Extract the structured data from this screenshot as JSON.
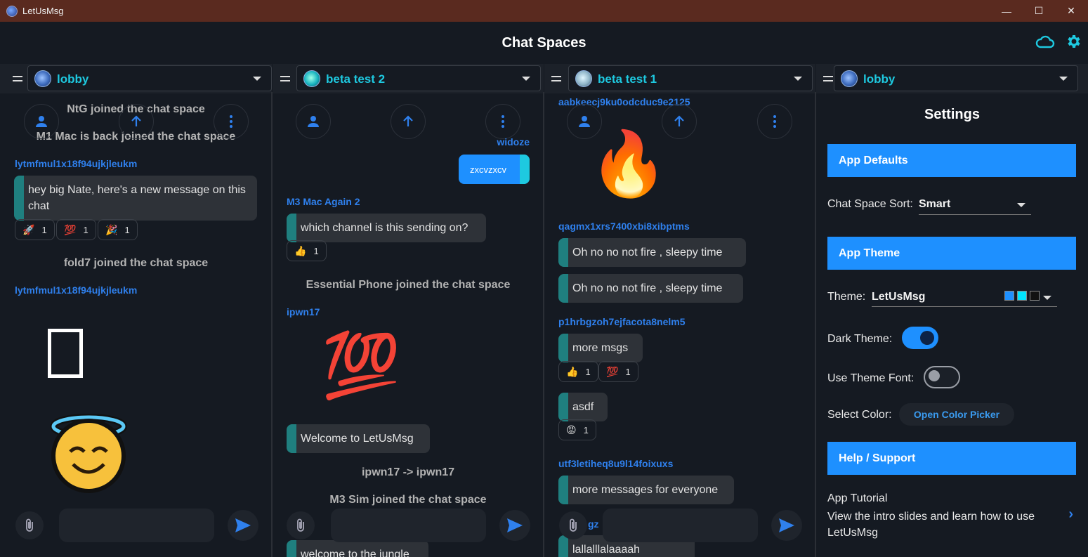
{
  "window": {
    "title": "LetUsMsg",
    "minimize": "—",
    "maximize": "☐",
    "close": "✕"
  },
  "header": {
    "title": "Chat Spaces",
    "cloud_icon": "cloud-icon",
    "settings_icon": "gear-icon"
  },
  "columns": [
    {
      "space": "lobby",
      "messages": {
        "sys1": "NtG joined the chat space",
        "sys2": "M1 Mac is back joined the chat space",
        "user1": "lytmfmul1x18f94ujkjleukm",
        "bubble1": "hey big Nate, here's a new message on this chat",
        "reactions": [
          {
            "emoji": "🚀",
            "count": "1"
          },
          {
            "emoji": "💯",
            "count": "1"
          },
          {
            "emoji": "🎉",
            "count": "1"
          }
        ],
        "sys3": "fold7 joined the chat space",
        "user2": "lytmfmul1x18f94ujkjleukm"
      }
    },
    {
      "space": "beta test 2",
      "messages": {
        "user_right": "widoze",
        "own_bubble": "zxcvzxcv",
        "user1": "M3 Mac Again 2",
        "bubble1": "which channel is this sending on?",
        "reaction1": {
          "emoji": "👍",
          "count": "1"
        },
        "sys1": "Essential Phone joined the chat space",
        "user2": "ipwn17",
        "emoji_big": "💯",
        "bubble2": "Welcome to LetUsMsg",
        "sys2": "ipwn17  ->  ipwn17",
        "sys3": "M3 Sim joined the chat space",
        "bubble3": "welcome to the jungle"
      }
    },
    {
      "space": "beta test 1",
      "messages": {
        "user1": "aabkeecj9ku0odcduc9e2125",
        "emoji_big": "🔥",
        "user2": "qagmx1xrs7400xbi8xibptms",
        "bubble1": "Oh no no not fire , sleepy time",
        "bubble2": "Oh no no not fire , sleepy time",
        "user3": "p1hrbgzoh7ejfacota8nelm5",
        "bubble3": "more msgs",
        "reactions": [
          {
            "emoji": "👍",
            "count": "1"
          },
          {
            "emoji": "💯",
            "count": "1"
          }
        ],
        "bubble4": "asdf",
        "reaction4": {
          "emoji": "😡",
          "count": "1"
        },
        "user4": "utf3letiheq8u9l14foixuxs",
        "bubble5": "more messages for everyone",
        "user5_partial": "gz",
        "bubble6": "lallalllalaaaah"
      }
    },
    {
      "space": "lobby"
    }
  ],
  "settings": {
    "title": "Settings",
    "app_defaults": "App Defaults",
    "sort_label": "Chat Space Sort:",
    "sort_value": "Smart",
    "app_theme": "App Theme",
    "theme_label": "Theme:",
    "theme_value": "LetUsMsg",
    "theme_colors": [
      "#1e90ff",
      "#00e5ff",
      "#121212"
    ],
    "dark_theme_label": "Dark Theme:",
    "dark_theme_on": true,
    "theme_font_label": "Use Theme Font:",
    "theme_font_on": false,
    "select_color_label": "Select Color:",
    "color_picker_button": "Open Color Picker",
    "help": "Help / Support",
    "tutorial_title": "App Tutorial",
    "tutorial_desc": "View the intro slides and learn how to use LetUsMsg"
  },
  "colors": {
    "accent": "#1e90ff",
    "cyan": "#1ec9e0",
    "bg": "#151a22",
    "bubble": "#2e3238",
    "bubble_bar": "#1f7f7f"
  }
}
